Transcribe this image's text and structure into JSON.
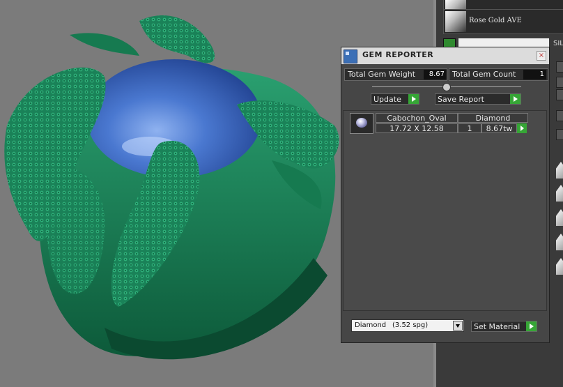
{
  "viewport": {
    "background_color": "#7b7b7b",
    "model_color": "#1c8a5e",
    "gem_color": "#3d6cc6"
  },
  "material_panel": {
    "items": [
      {
        "label": "",
        "icon": "material-swatch-icon"
      },
      {
        "label": "Rose Gold AVE",
        "icon": "material-swatch-icon"
      }
    ],
    "silver_label": "SILV"
  },
  "gem_reporter": {
    "title": "GEM REPORTER",
    "close_symbol": "×",
    "total_gem_weight_label": "Total Gem Weight",
    "total_gem_weight_value": "8.67",
    "total_gem_count_label": "Total Gem Count",
    "total_gem_count_value": "1",
    "update_label": "Update",
    "save_report_label": "Save Report",
    "gems": [
      {
        "cut": "Cabochon_Oval",
        "material": "Diamond",
        "dimensions": "17.72 X 12.58",
        "count": "1",
        "weight": "8.67tw"
      }
    ],
    "material_select": {
      "name": "Diamond",
      "spg": "(3.52 spg)"
    },
    "set_material_label": "Set Material"
  }
}
